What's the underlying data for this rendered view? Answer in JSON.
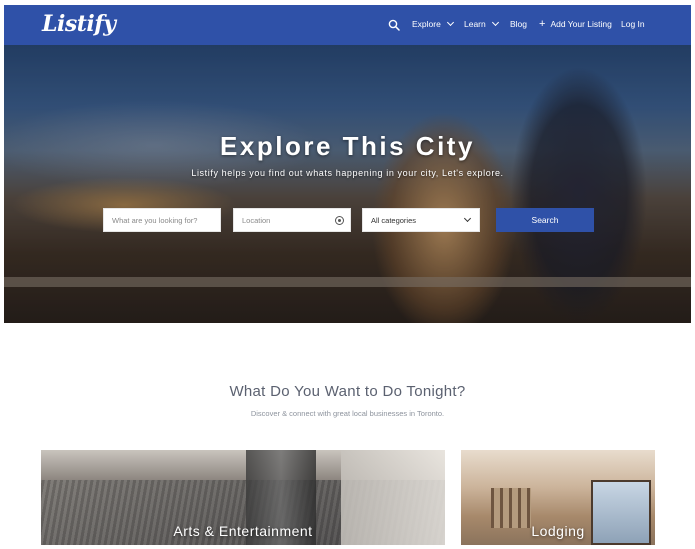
{
  "header": {
    "logo": "Listify",
    "nav": {
      "explore": "Explore",
      "learn": "Learn",
      "blog": "Blog",
      "add_listing": "Add Your Listing",
      "login": "Log In"
    }
  },
  "hero": {
    "title": "Explore This City",
    "subtitle": "Listify helps you find out whats happening in your city, Let's explore.",
    "search": {
      "what_placeholder": "What are you looking for?",
      "location_placeholder": "Location",
      "category_value": "All categories",
      "button_label": "Search"
    }
  },
  "section": {
    "title": "What Do You Want to Do Tonight?",
    "subtitle": "Discover & connect with great local businesses in Toronto."
  },
  "cards": [
    {
      "label": "Arts & Entertainment"
    },
    {
      "label": "Lodging"
    }
  ],
  "colors": {
    "brand": "#2f51a8"
  },
  "icons": {
    "search": "search-icon",
    "location": "crosshair-icon",
    "dropdown": "chevron-down-icon",
    "add": "plus-icon"
  }
}
